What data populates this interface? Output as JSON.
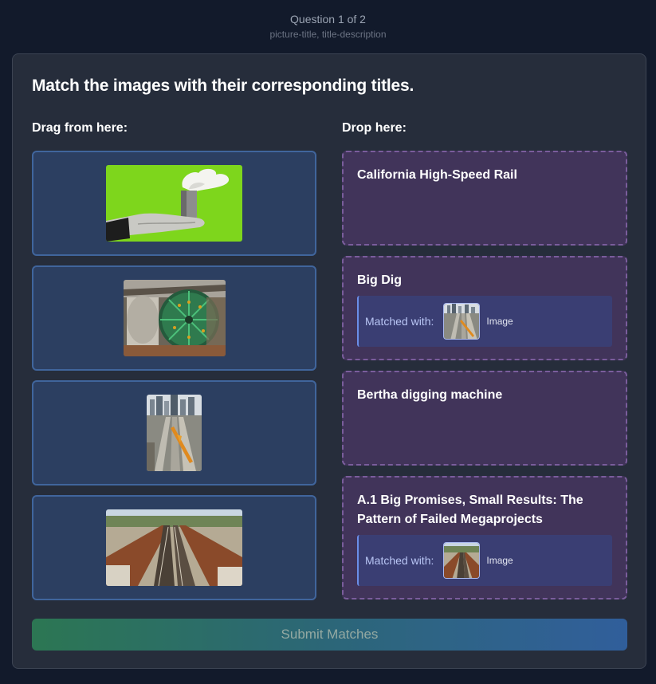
{
  "header": {
    "question_count": "Question 1 of 2",
    "question_type": "picture-title, title-description"
  },
  "card": {
    "heading": "Match the images with their corresponding titles.",
    "drag_label": "Drag from here:",
    "drop_label": "Drop here:"
  },
  "drag_items": [
    {
      "subject": "hand holding smokestack on green background"
    },
    {
      "subject": "tunnel boring machine cutterhead"
    },
    {
      "subject": "city skyline above construction site"
    },
    {
      "subject": "elevated rail viaduct construction"
    }
  ],
  "drop_zones": [
    {
      "title": "California High-Speed Rail",
      "matched": false
    },
    {
      "title": "Big Dig",
      "matched": true,
      "matched_label": "Matched with:",
      "matched_text": "Image"
    },
    {
      "title": "Bertha digging machine",
      "matched": false
    },
    {
      "title": "A.1 Big Promises, Small Results: The Pattern of Failed Megaprojects",
      "matched": true,
      "matched_label": "Matched with:",
      "matched_text": "Image"
    }
  ],
  "submit_label": "Submit Matches",
  "colors": {
    "background": "#121a2b",
    "card": "#262d3b",
    "drag_item": "#2c3f61",
    "drop_zone": "#41345a",
    "submit_start": "#2c7a54",
    "submit_end": "#3161a0"
  }
}
